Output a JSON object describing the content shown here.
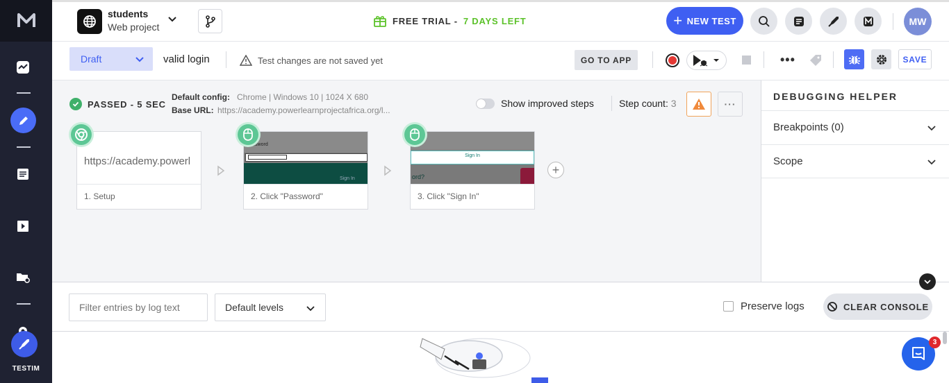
{
  "app": {
    "brand_label": "TESTIM",
    "logo_letter": "M"
  },
  "header": {
    "project_name": "students",
    "project_type": "Web project",
    "trial_prefix": "FREE TRIAL -",
    "trial_days": "7 DAYS LEFT",
    "new_test_label": "NEW TEST",
    "avatar_initials": "MW"
  },
  "toolbar": {
    "status_select": "Draft",
    "test_name": "valid login",
    "unsaved_note": "Test changes are not saved yet",
    "goto_app_label": "GO TO APP",
    "save_label": "SAVE"
  },
  "run": {
    "status": "PASSED - 5 SEC",
    "config_label": "Default config:",
    "config_value": "Chrome | Windows 10 | 1024 X 680",
    "base_url_label": "Base URL:",
    "base_url_value": "https://academy.powerlearnprojectafrica.org/l...",
    "improved_steps_label": "Show improved steps",
    "step_count_label": "Step count:",
    "step_count_value": "3"
  },
  "steps": [
    {
      "label": "1. Setup",
      "thumb_text": "https://academy.powerl",
      "icon": "chrome-icon"
    },
    {
      "label": "2. Click \"Password\"",
      "thumb_text": "Password",
      "thumb_button": "Sign In",
      "icon": "mouse-icon"
    },
    {
      "label": "3. Click \"Sign In\"",
      "thumb_text": "Sign In",
      "thumb_sub": "ord?",
      "icon": "mouse-icon"
    }
  ],
  "debug_panel": {
    "title": "DEBUGGING HELPER",
    "items": [
      {
        "label": "Breakpoints (0)"
      },
      {
        "label": "Scope"
      }
    ]
  },
  "console": {
    "filter_placeholder": "Filter entries by log text",
    "levels_value": "Default levels",
    "preserve_label": "Preserve logs",
    "clear_label": "CLEAR CONSOLE"
  },
  "chat": {
    "badge_count": "3"
  },
  "colors": {
    "accent": "#3f5ff2",
    "sidebar": "#1f2232",
    "pass": "#3fb06a",
    "trial_green": "#5cc22a",
    "record": "#e53935"
  }
}
